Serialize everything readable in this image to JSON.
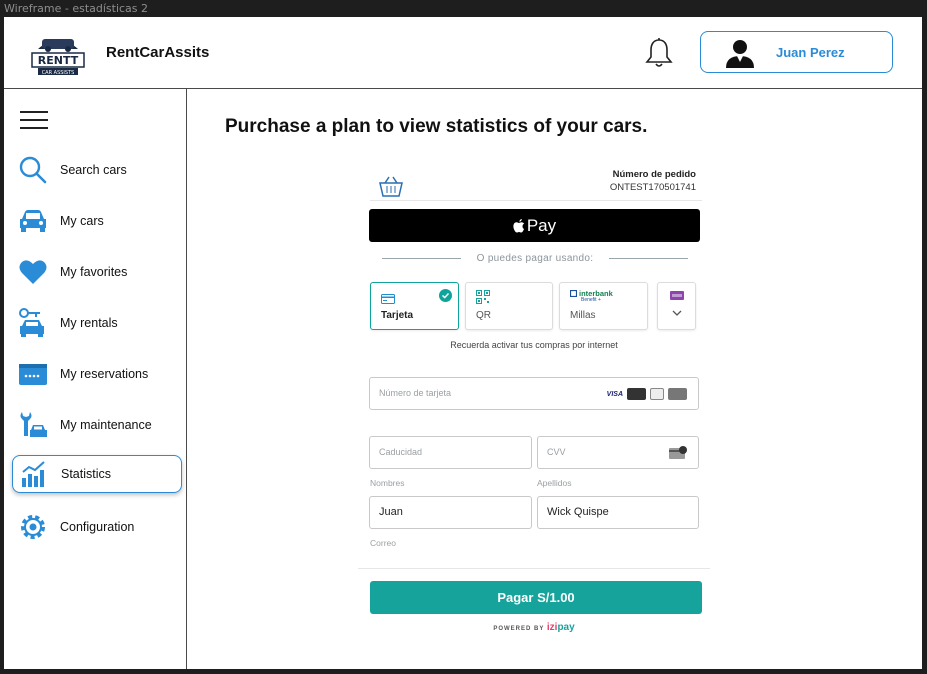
{
  "window": {
    "title": "Wireframe - estadísticas 2"
  },
  "header": {
    "brand": "RentCarAssits",
    "logo_text_top": "RENTT",
    "logo_text_bottom": "CAR ASSISTS",
    "user_name": "Juan Perez"
  },
  "sidebar": {
    "items": [
      {
        "label": "Search cars",
        "icon": "search-icon"
      },
      {
        "label": "My cars",
        "icon": "car-icon"
      },
      {
        "label": "My favorites",
        "icon": "heart-icon"
      },
      {
        "label": "My rentals",
        "icon": "key-car-icon"
      },
      {
        "label": "My reservations",
        "icon": "calendar-icon"
      },
      {
        "label": "My maintenance",
        "icon": "wrench-car-icon"
      },
      {
        "label": "Statistics",
        "icon": "bar-chart-icon",
        "active": true
      },
      {
        "label": "Configuration",
        "icon": "gear-icon"
      }
    ]
  },
  "main": {
    "title": "Purchase a plan to view statistics of your cars."
  },
  "payment": {
    "order_label": "Número de pedido",
    "order_id": "ONTEST170501741",
    "apple_pay": "Pay",
    "alt_text": "O puedes pagar usando:",
    "methods": [
      {
        "label": "Tarjeta",
        "selected": true
      },
      {
        "label": "QR"
      },
      {
        "label": "Millas",
        "brand": "interbank",
        "sub": "Benefit +"
      },
      {
        "label": ""
      }
    ],
    "remember": "Recuerda activar tus compras por internet",
    "card_placeholder": "Número de tarjeta",
    "exp_placeholder": "Caducidad",
    "cvv_placeholder": "CVV",
    "first_name_caption": "Nombres",
    "last_name_caption": "Apellidos",
    "first_name": "Juan",
    "last_name": "Wick Quispe",
    "email_caption": "Correo",
    "pay_button": "Pagar S/1.00",
    "powered_by": "POWERED BY",
    "powered_brand_a": "izi",
    "powered_brand_b": "pay"
  },
  "colors": {
    "accent": "#2a8bd6",
    "pay_green": "#16a39b",
    "icon_blue": "#2a8bd6"
  }
}
